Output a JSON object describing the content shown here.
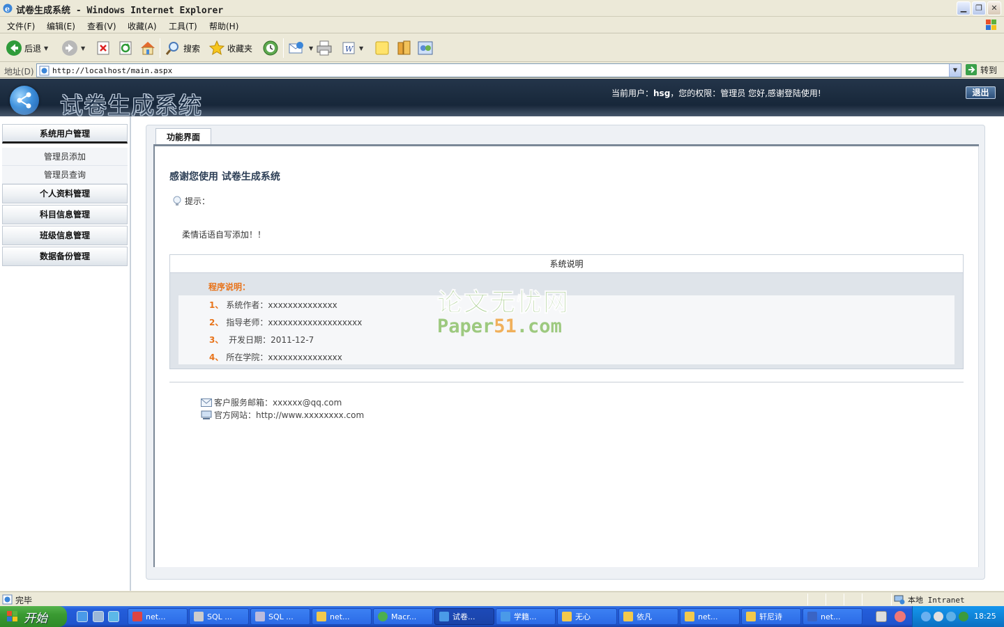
{
  "window": {
    "title": "试卷生成系统 - Windows Internet Explorer",
    "menus": [
      "文件(F)",
      "编辑(E)",
      "查看(V)",
      "收藏(A)",
      "工具(T)",
      "帮助(H)"
    ]
  },
  "toolbar": {
    "back_label": "后退",
    "search_label": "搜索",
    "favorites_label": "收藏夹"
  },
  "address": {
    "label": "地址(D)",
    "url": "http://localhost/main.aspx",
    "go_label": "转到"
  },
  "header": {
    "system_title": "试卷生成系统",
    "user_prefix": "当前用户：",
    "username": "hsg",
    "user_suffix": "，您的权限：管理员  您好,感谢登陆使用!",
    "logout_label": "退出"
  },
  "sidebar": {
    "groups": [
      {
        "label": "系统用户管理",
        "items": [
          "管理员添加",
          "管理员查询"
        ]
      },
      {
        "label": "个人资料管理"
      },
      {
        "label": "科目信息管理"
      },
      {
        "label": "班级信息管理"
      },
      {
        "label": "数据备份管理"
      }
    ]
  },
  "main": {
    "tab_label": "功能界面",
    "welcome": "感谢您使用 试卷生成系统",
    "hint_label": "提示：",
    "tender_text": "柔情话语自写添加！！",
    "sys_header": "系统说明",
    "program_title": "程序说明：",
    "rows": [
      {
        "num": "1、",
        "text": "系统作者：xxxxxxxxxxxxxx"
      },
      {
        "num": "2、",
        "text": "指导老师：xxxxxxxxxxxxxxxxxxx"
      },
      {
        "num": "3、",
        "text": " 开发日期：2011-12-7"
      },
      {
        "num": "4、",
        "text": "所在学院：xxxxxxxxxxxxxxx"
      }
    ],
    "email": "客户服务邮箱：xxxxxx@qq.com",
    "website": "官方网站：http://www.xxxxxxxx.com"
  },
  "watermark": {
    "cn": "论文无忧网",
    "en_prefix": "Paper",
    "en_num": "51",
    "en_suffix": ".com"
  },
  "status": {
    "text": "完毕",
    "zone": "本地 Intranet"
  },
  "taskbar": {
    "start_label": "开始",
    "tasks": [
      "net...",
      "SQL ...",
      "SQL ...",
      "net...",
      "Macr...",
      "试卷...",
      "学籍...",
      "无心",
      "依凡",
      "net...",
      "轩尼诗",
      "net..."
    ],
    "clock": "18:25"
  }
}
